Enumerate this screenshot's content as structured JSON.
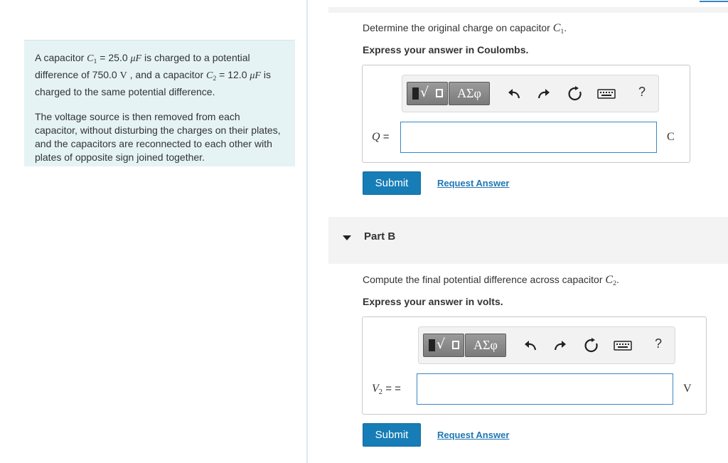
{
  "problem": {
    "para1": {
      "t1": "A capacitor ",
      "c1_sym": "C",
      "c1_sub": "1",
      "t2": " = 25.0 ",
      "mu1": "μF",
      "t3": " is charged to a potential difference of 750.0 ",
      "volt": "V",
      "t4": " , and a capacitor ",
      "c2_sym": "C",
      "c2_sub": "2",
      "t5": " = 12.0 ",
      "mu2": "μF",
      "t6": " is charged to the same potential difference."
    },
    "para2": "The voltage source is then removed from each capacitor, without disturbing the charges on their plates, and the capacitors are reconnected to each other with plates of opposite sign joined together."
  },
  "part_a": {
    "prompt_text": "Determine the original charge on capacitor ",
    "prompt_sym": "C",
    "prompt_sub": "1",
    "prompt_end": ".",
    "instruction": "Express your answer in Coulombs.",
    "var_label": "Q",
    "equals": " =",
    "input_value": "",
    "unit": "C",
    "submit_label": "Submit",
    "request_label": "Request Answer"
  },
  "part_b": {
    "title": "Part B",
    "prompt_text": "Compute the final potential difference across capacitor ",
    "prompt_sym": "C",
    "prompt_sub": "2",
    "prompt_end": ".",
    "instruction": "Express your answer in volts.",
    "var_sym": "V",
    "var_sub": "2",
    "equals": " = =",
    "input_value": "",
    "unit": "V",
    "submit_label": "Submit",
    "request_label": "Request Answer"
  },
  "toolbar": {
    "greek_label": "ΑΣφ",
    "help_label": "?",
    "icons": [
      "templates-icon",
      "greek-symbols-icon",
      "undo-icon",
      "redo-icon",
      "reset-icon",
      "keyboard-icon",
      "help-icon"
    ]
  },
  "colors": {
    "problem_bg": "#e5f3f5",
    "submit_bg": "#177db7",
    "link": "#1f77b4",
    "input_border": "#3a87c5"
  }
}
